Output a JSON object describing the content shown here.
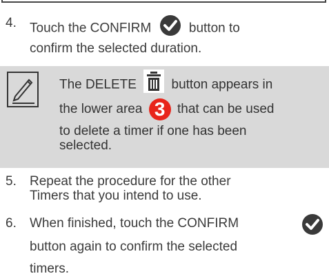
{
  "step4": {
    "number": "4.",
    "text_before": "Touch the CONFIRM",
    "text_after": "button to",
    "line2": "confirm the selected duration.",
    "icon": "confirm-check-icon"
  },
  "note": {
    "icon": "pencil-note-icon",
    "line1_before": "The DELETE",
    "line1_after": "button appears in",
    "line2_before": "the lower area",
    "badge": "3",
    "line2_after": "that can be used",
    "line3": "to delete a timer if one has been",
    "line4": "selected.",
    "delete_icon": "trash-icon"
  },
  "step5": {
    "number": "5.",
    "line1": "Repeat the procedure for the other",
    "line2": "Timers that you intend to use."
  },
  "step6": {
    "number": "6.",
    "line1": "When finished, touch the CONFIRM",
    "line2": "button again to confirm the selected",
    "line3": "timers.",
    "icon": "confirm-check-icon"
  },
  "colors": {
    "note_bg": "#d9d9d9",
    "badge": "#e8251b",
    "icon_dark": "#3a3a3a"
  }
}
